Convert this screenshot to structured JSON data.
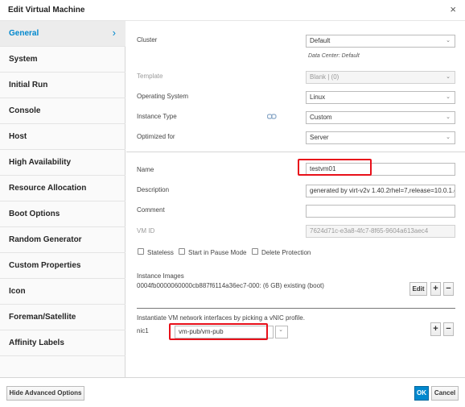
{
  "dialog": {
    "title": "Edit Virtual Machine",
    "close_glyph": "×"
  },
  "sidebar": {
    "items": [
      {
        "label": "General",
        "active": true
      },
      {
        "label": "System"
      },
      {
        "label": "Initial Run"
      },
      {
        "label": "Console"
      },
      {
        "label": "Host"
      },
      {
        "label": "High Availability"
      },
      {
        "label": "Resource Allocation"
      },
      {
        "label": "Boot Options"
      },
      {
        "label": "Random Generator"
      },
      {
        "label": "Custom Properties"
      },
      {
        "label": "Icon"
      },
      {
        "label": "Foreman/Satellite"
      },
      {
        "label": "Affinity Labels"
      }
    ],
    "active_chevron": "›"
  },
  "general": {
    "cluster": {
      "label": "Cluster",
      "value": "Default",
      "note": "Data Center: Default"
    },
    "template": {
      "label": "Template",
      "value": "Blank | (0)"
    },
    "os": {
      "label": "Operating System",
      "value": "Linux"
    },
    "instance_type": {
      "label": "Instance Type",
      "value": "Custom"
    },
    "optimized_for": {
      "label": "Optimized for",
      "value": "Server"
    },
    "name": {
      "label": "Name",
      "value": "testvm01"
    },
    "description": {
      "label": "Description",
      "value": "generated by virt-v2v 1.40.2rhel=7,release=10.0.1.e"
    },
    "comment": {
      "label": "Comment",
      "value": ""
    },
    "vm_id": {
      "label": "VM ID",
      "value": "7624d71c-e3a8-4fc7-8f65-9604a613aec4"
    },
    "checkboxes": [
      {
        "label": "Stateless",
        "checked": false
      },
      {
        "label": "Start in Pause Mode",
        "checked": false
      },
      {
        "label": "Delete Protection",
        "checked": false
      }
    ],
    "instance_images": {
      "label": "Instance Images",
      "disk": "0004fb0000060000cb887f6114a36ec7-000: (6 GB) existing (boot)",
      "edit_label": "Edit",
      "plus": "+",
      "minus": "−"
    },
    "network": {
      "caption": "Instantiate VM network interfaces by picking a vNIC profile.",
      "nic_label": "nic1",
      "nic_value": "vm-pub/vm-pub",
      "plus": "+",
      "minus": "−"
    }
  },
  "footer": {
    "advanced_label": "Hide Advanced Options",
    "ok_label": "OK",
    "cancel_label": "Cancel"
  },
  "colors": {
    "accent": "#0088ce",
    "highlight": "#e8101a"
  }
}
